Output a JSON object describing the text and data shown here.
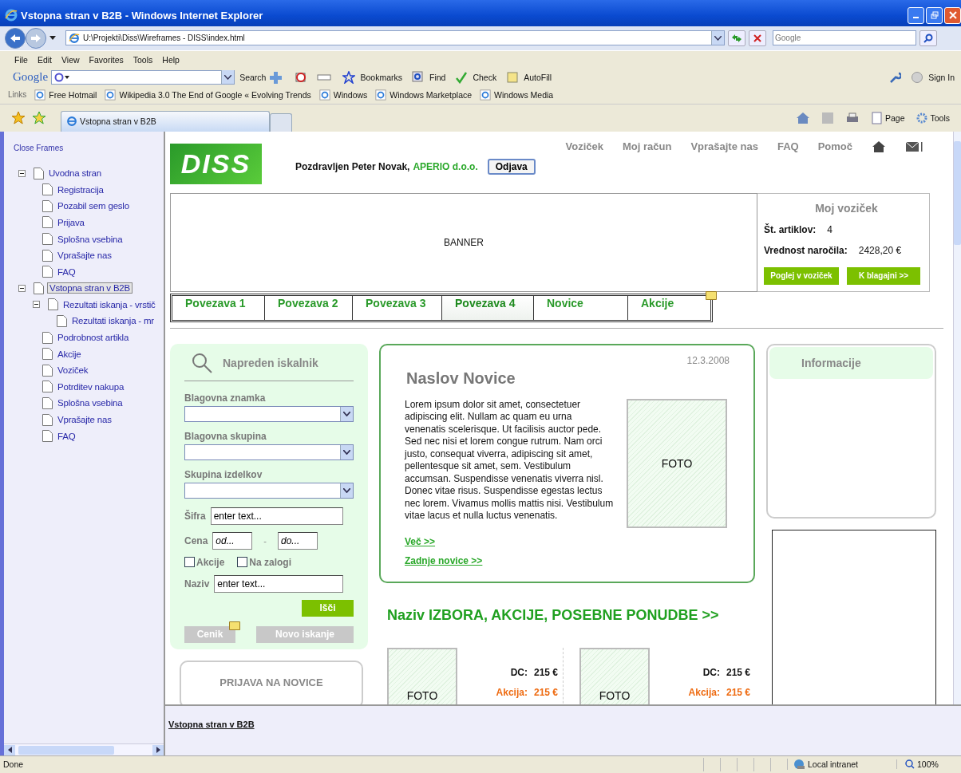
{
  "window": {
    "title": "Vstopna stran v B2B - Windows Internet Explorer"
  },
  "address_bar": {
    "url": "U:\\Projekti\\Diss\\Wireframes - DISS\\index.html",
    "search_placeholder": "Google"
  },
  "menu": [
    "File",
    "Edit",
    "View",
    "Favorites",
    "Tools",
    "Help"
  ],
  "google_toolbar": {
    "logo": "Google",
    "search_label": "Search",
    "items": [
      "Bookmarks",
      "Find",
      "Check",
      "AutoFill"
    ],
    "sign_in": "Sign In"
  },
  "links_bar": {
    "label": "Links",
    "items": [
      "Free Hotmail",
      "Wikipedia 3.0 The End of Google « Evolving Trends",
      "Windows",
      "Windows Marketplace",
      "Windows Media"
    ]
  },
  "tabs": [
    {
      "label": "Vstopna stran v B2B",
      "selected": true
    }
  ],
  "command_bar": [
    "Page",
    "Tools"
  ],
  "sidebar": {
    "close_frames": "Close Frames",
    "tree": [
      {
        "label": "Uvodna stran",
        "selected": false,
        "expanded": true,
        "children": [
          {
            "label": "Registracija",
            "selected": false
          },
          {
            "label": "Pozabil sem geslo",
            "selected": false
          },
          {
            "label": "Prijava",
            "selected": false
          },
          {
            "label": "Splošna vsebina",
            "selected": false
          },
          {
            "label": "Vprašajte nas",
            "selected": false
          },
          {
            "label": "FAQ",
            "selected": false
          }
        ]
      },
      {
        "label": "Vstopna stran v B2B",
        "selected": true,
        "expanded": true,
        "children": [
          {
            "label": "Rezultati iskanja - vrstič",
            "selected": false,
            "expanded": true,
            "children": [
              {
                "label": "Rezultati iskanja - mr",
                "selected": false
              }
            ]
          },
          {
            "label": "Podrobnost artikla",
            "selected": false
          },
          {
            "label": "Akcije",
            "selected": false
          },
          {
            "label": "Voziček",
            "selected": false
          },
          {
            "label": "Potrditev nakupa",
            "selected": false
          },
          {
            "label": "Splošna vsebina",
            "selected": false
          },
          {
            "label": "Vprašajte nas",
            "selected": false
          },
          {
            "label": "FAQ",
            "selected": false
          }
        ]
      }
    ]
  },
  "header": {
    "logo": "DISS",
    "greeting": "Pozdravljen Peter Novak,",
    "company": "APERIO d.o.o.",
    "logout": "Odjava",
    "top_nav": [
      "Voziček",
      "Moj račun",
      "Vprašajte nas",
      "FAQ",
      "Pomoč"
    ]
  },
  "banner": "BANNER",
  "cart": {
    "title": "Moj voziček",
    "rows": [
      {
        "label": "Št. artiklov:",
        "value": "4"
      },
      {
        "label": "Vrednost naročila:",
        "value": "2428,20 €"
      }
    ],
    "buttons": [
      "Poglej v voziček",
      "K blagajni  >>"
    ]
  },
  "nav_tabs": [
    {
      "label": "Povezava 1",
      "selected": false
    },
    {
      "label": "Povezava 2",
      "selected": false
    },
    {
      "label": "Povezava 3",
      "selected": false
    },
    {
      "label": "Povezava 4",
      "selected": true
    },
    {
      "label": "Novice",
      "selected": false
    },
    {
      "label": "Akcije",
      "selected": false
    }
  ],
  "search_panel": {
    "title": "Napreden iskalnik",
    "selects": [
      "Blagovna znamka",
      "Blagovna skupina",
      "Skupina izdelkov"
    ],
    "code": {
      "label": "Šifra",
      "value": "enter text..."
    },
    "price": {
      "label": "Cena",
      "from": "od...",
      "separator": "-",
      "to": "do..."
    },
    "checkboxes": [
      {
        "label": "Akcije",
        "checked": false
      },
      {
        "label": "Na zalogi",
        "checked": false
      }
    ],
    "name": {
      "label": "Naziv",
      "value": "enter text..."
    },
    "search_button": "Išči",
    "buttons": [
      {
        "label": "Cenik",
        "disabled": true
      },
      {
        "label": "Novo iskanje",
        "disabled": true
      }
    ]
  },
  "newsletter": {
    "title": "PRIJAVA NA NOVICE"
  },
  "news": {
    "date": "12.3.2008",
    "title": "Naslov Novice",
    "body": "Lorem ipsum dolor sit amet, consectetuer adipiscing elit. Nullam ac quam eu urna venenatis scelerisque. Ut facilisis auctor pede. Sed nec nisi et lorem congue rutrum. Nam orci justo, consequat viverra, adipiscing sit amet, pellentesque sit amet, sem. Vestibulum accumsan. Suspendisse venenatis viverra nisl. Donec vitae risus. Suspendisse egestas lectus nec lorem. Vivamus mollis mattis nisi. Vestibulum vitae lacus et nulla luctus venenatis.",
    "photo_label": "FOTO",
    "links": [
      "Več >>",
      "Zadnje novice >>"
    ]
  },
  "promo": {
    "title": "Naziv IZBORA, AKCIJE, POSEBNE PONUDBE  >>",
    "products": [
      {
        "photo_label": "FOTO",
        "dc_label": "DC:",
        "dc": "215 €",
        "action_label": "Akcija:",
        "action": "215 €"
      },
      {
        "photo_label": "FOTO",
        "dc_label": "DC:",
        "dc": "215 €",
        "action_label": "Akcija:",
        "action": "215 €"
      }
    ]
  },
  "info": {
    "title": "Informacije"
  },
  "bottom_frame": {
    "link": "Vstopna stran v B2B"
  },
  "status_bar": {
    "text": "Done",
    "zone": "Local intranet",
    "zoom": "100%"
  }
}
